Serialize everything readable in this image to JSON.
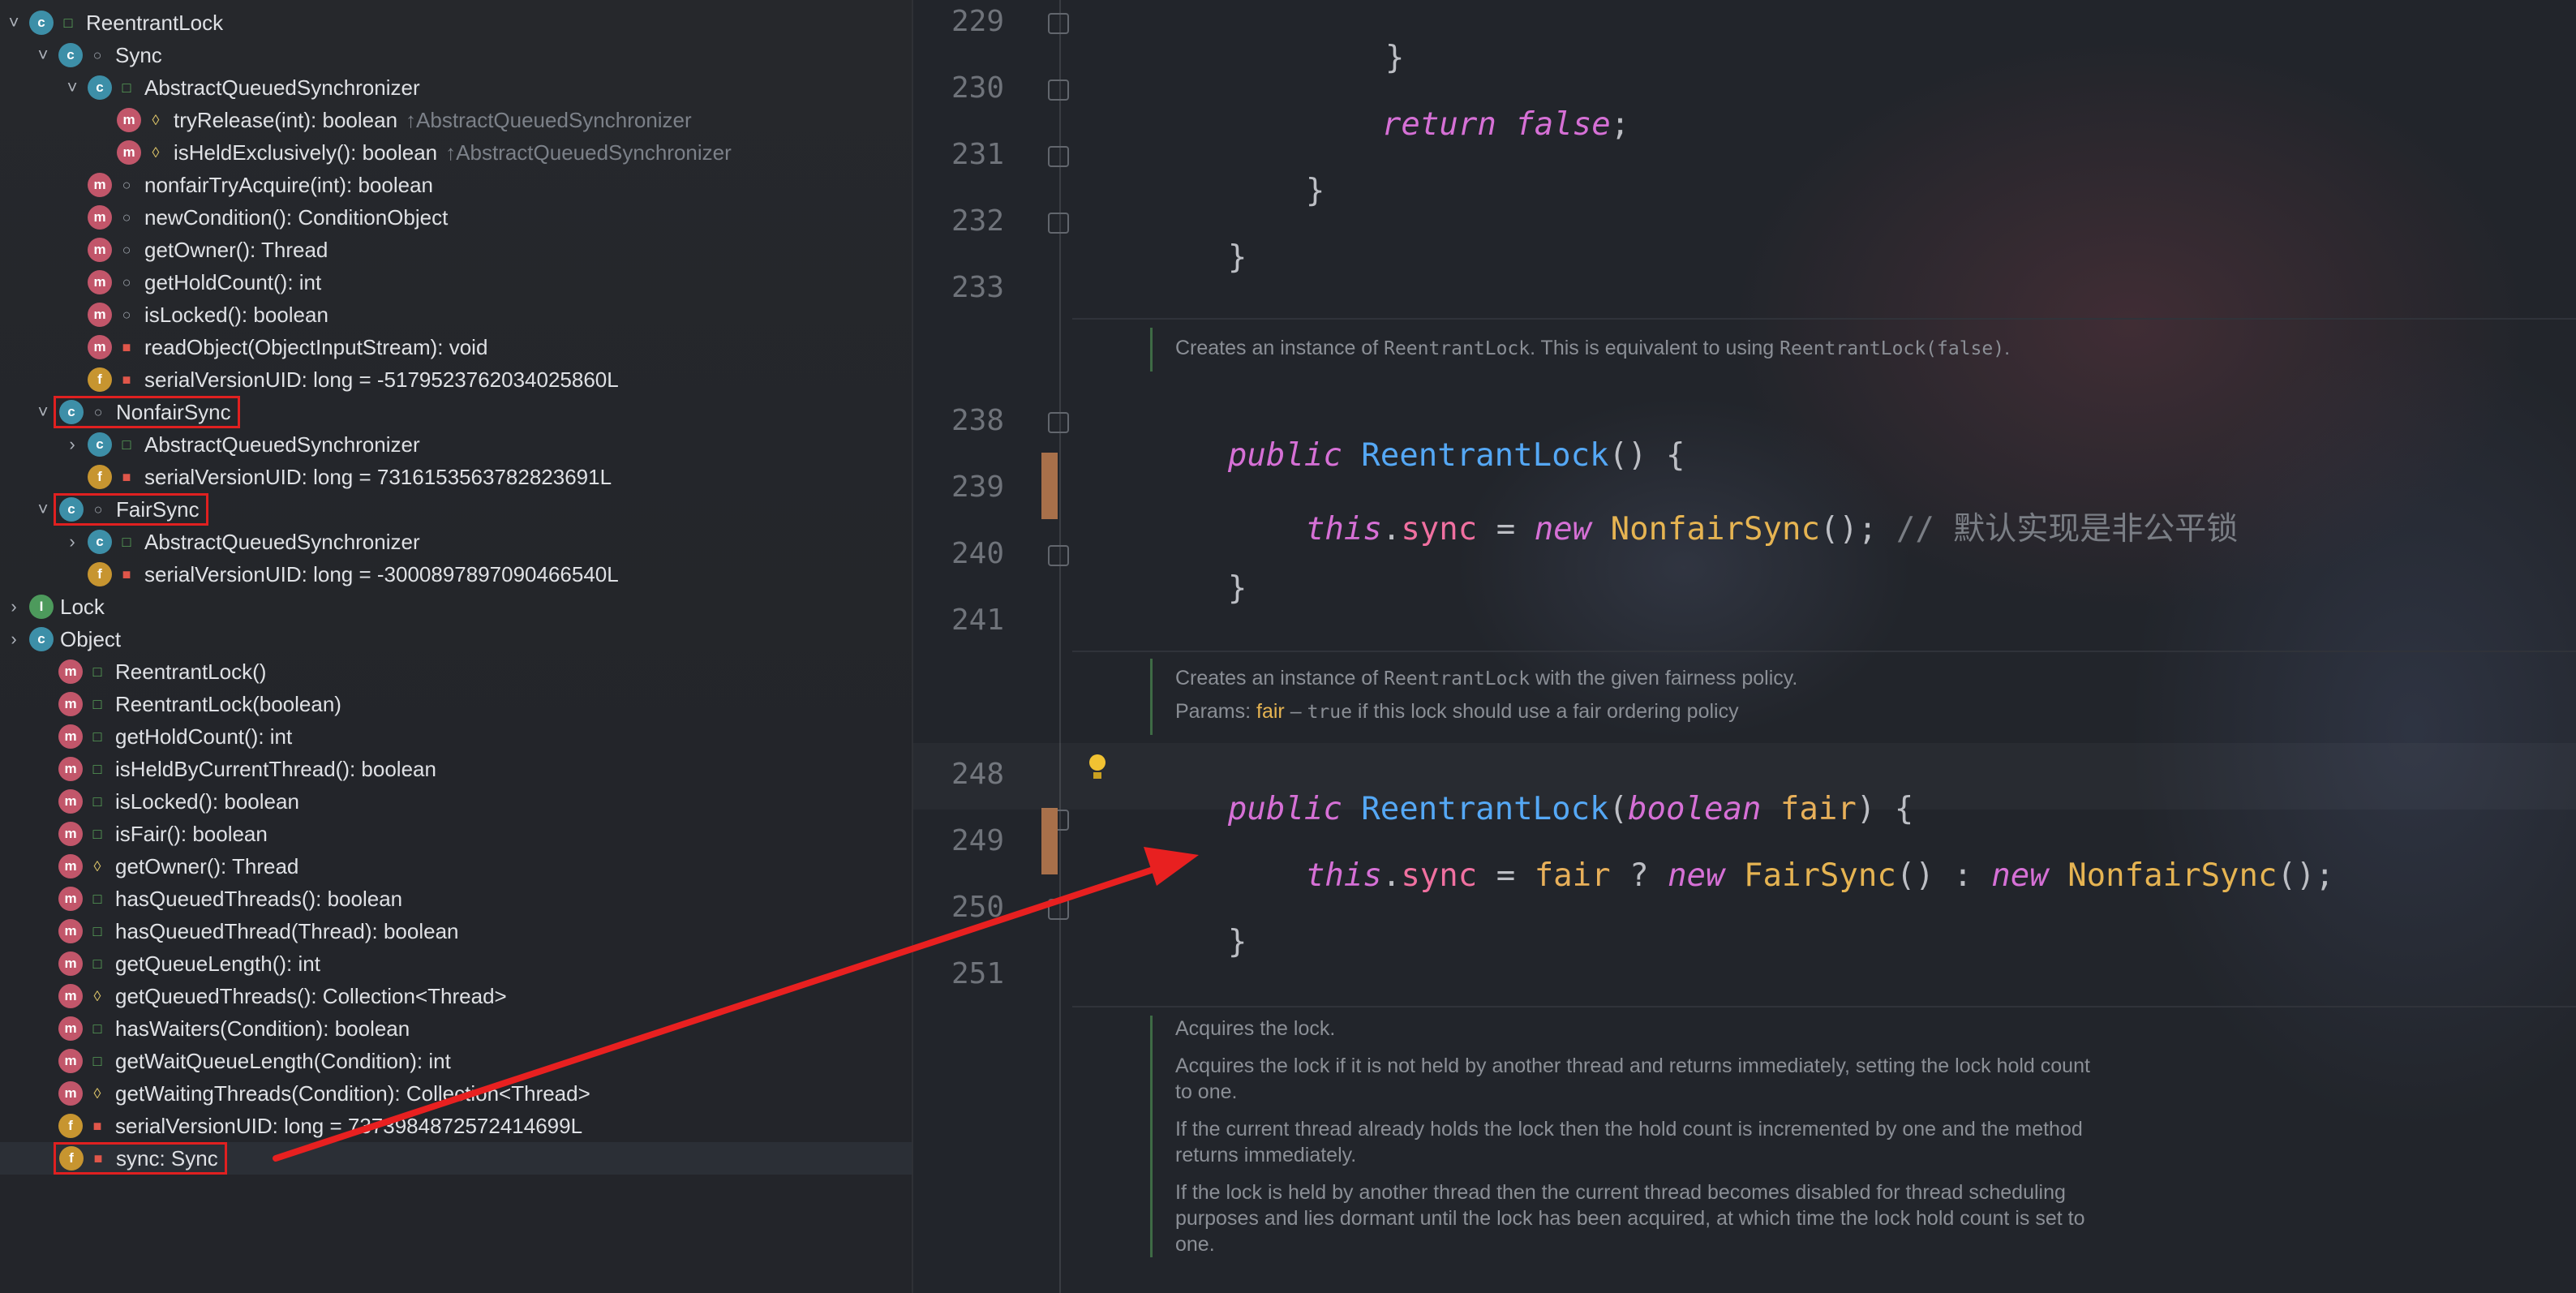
{
  "structure": {
    "rows": [
      {
        "label": "ReentrantLock",
        "icon": "class-icon",
        "vis": "public",
        "indent": 0,
        "chev": "down"
      },
      {
        "label": "Sync",
        "icon": "class-icon",
        "vis": "package",
        "indent": 1,
        "chev": "down"
      },
      {
        "label": "AbstractQueuedSynchronizer",
        "icon": "class-icon",
        "vis": "public",
        "indent": 2,
        "chev": "down"
      },
      {
        "label": "tryRelease(int): boolean",
        "inherit": "↑AbstractQueuedSynchronizer",
        "icon": "method-icon",
        "vis": "protected",
        "indent": 3
      },
      {
        "label": "isHeldExclusively(): boolean",
        "inherit": "↑AbstractQueuedSynchronizer",
        "icon": "method-icon",
        "vis": "protected",
        "indent": 3
      },
      {
        "label": "nonfairTryAcquire(int): boolean",
        "icon": "method-icon",
        "vis": "package",
        "indent": 2
      },
      {
        "label": "newCondition(): ConditionObject",
        "icon": "method-icon",
        "vis": "package",
        "indent": 2
      },
      {
        "label": "getOwner(): Thread",
        "icon": "method-icon",
        "vis": "package",
        "indent": 2
      },
      {
        "label": "getHoldCount(): int",
        "icon": "method-icon",
        "vis": "package",
        "indent": 2
      },
      {
        "label": "isLocked(): boolean",
        "icon": "method-icon",
        "vis": "package",
        "indent": 2
      },
      {
        "label": "readObject(ObjectInputStream): void",
        "icon": "method-icon",
        "vis": "private",
        "indent": 2
      },
      {
        "label": "serialVersionUID: long = -5179523762034025860L",
        "icon": "field-icon",
        "vis": "private",
        "indent": 2
      },
      {
        "label": "NonfairSync",
        "icon": "class-icon",
        "vis": "package",
        "indent": 1,
        "chev": "down",
        "boxed": true
      },
      {
        "label": "AbstractQueuedSynchronizer",
        "icon": "class-icon",
        "vis": "public",
        "indent": 2,
        "chev": "right"
      },
      {
        "label": "serialVersionUID: long = 7316153563782823691L",
        "icon": "field-icon",
        "vis": "private",
        "indent": 2
      },
      {
        "label": "FairSync",
        "icon": "class-icon",
        "vis": "package",
        "indent": 1,
        "chev": "down",
        "boxed": true
      },
      {
        "label": "AbstractQueuedSynchronizer",
        "icon": "class-icon",
        "vis": "public",
        "indent": 2,
        "chev": "right"
      },
      {
        "label": "serialVersionUID: long = -3000897897090466540L",
        "icon": "field-icon",
        "vis": "private",
        "indent": 2
      },
      {
        "label": "Lock",
        "icon": "interface-icon",
        "vis": "none",
        "indent": 0,
        "chev": "right"
      },
      {
        "label": "Object",
        "icon": "class-icon",
        "vis": "none",
        "indent": 0,
        "chev": "right"
      },
      {
        "label": "ReentrantLock()",
        "icon": "method-icon",
        "vis": "public",
        "indent": 1
      },
      {
        "label": "ReentrantLock(boolean)",
        "icon": "method-icon",
        "vis": "public",
        "indent": 1
      },
      {
        "label": "getHoldCount(): int",
        "icon": "method-icon",
        "vis": "public",
        "indent": 1
      },
      {
        "label": "isHeldByCurrentThread(): boolean",
        "icon": "method-icon",
        "vis": "public",
        "indent": 1
      },
      {
        "label": "isLocked(): boolean",
        "icon": "method-icon",
        "vis": "public",
        "indent": 1
      },
      {
        "label": "isFair(): boolean",
        "icon": "method-icon",
        "vis": "public",
        "indent": 1
      },
      {
        "label": "getOwner(): Thread",
        "icon": "method-icon",
        "vis": "protected",
        "indent": 1
      },
      {
        "label": "hasQueuedThreads(): boolean",
        "icon": "method-icon",
        "vis": "public",
        "indent": 1
      },
      {
        "label": "hasQueuedThread(Thread): boolean",
        "icon": "method-icon",
        "vis": "public",
        "indent": 1
      },
      {
        "label": "getQueueLength(): int",
        "icon": "method-icon",
        "vis": "public",
        "indent": 1
      },
      {
        "label": "getQueuedThreads(): Collection<Thread>",
        "icon": "method-icon",
        "vis": "protected",
        "indent": 1
      },
      {
        "label": "hasWaiters(Condition): boolean",
        "icon": "method-icon",
        "vis": "public",
        "indent": 1
      },
      {
        "label": "getWaitQueueLength(Condition): int",
        "icon": "method-icon",
        "vis": "public",
        "indent": 1
      },
      {
        "label": "getWaitingThreads(Condition): Collection<Thread>",
        "icon": "method-icon",
        "vis": "protected",
        "indent": 1
      },
      {
        "label": "serialVersionUID: long = 7373984872572414699L",
        "icon": "field-icon",
        "vis": "private",
        "indent": 1
      },
      {
        "label": "sync: Sync",
        "icon": "field-icon",
        "vis": "private",
        "indent": 1,
        "boxed": true,
        "selected": true
      }
    ]
  },
  "editor": {
    "line_numbers": {
      "l229": "229",
      "l230": "230",
      "l231": "231",
      "l232": "232",
      "l233": "233",
      "l238": "238",
      "l239": "239",
      "l240": "240",
      "l241": "241",
      "l248": "248",
      "l249": "249",
      "l250": "250",
      "l251": "251"
    },
    "code": {
      "l229_brace": "}",
      "l230_return": "return",
      "l230_false": "false",
      "l230_semi": ";",
      "l231_brace": "}",
      "l232_brace": "}",
      "l238_public": "public",
      "l238_name": "ReentrantLock",
      "l238_rest": "() {",
      "l239_this": "this",
      "l239_dot": ".",
      "l239_sync": "sync",
      "l239_eq": " = ",
      "l239_new": "new",
      "l239_type": "NonfairSync",
      "l239_rest": "(); ",
      "l239_comment": "// 默认实现是非公平锁",
      "l240_brace": "}",
      "l248_public": "public",
      "l248_name": "ReentrantLock",
      "l248_open": "(",
      "l248_boolean": "boolean",
      "l248_fair": "fair",
      "l248_rest": ") {",
      "l249_this": "this",
      "l249_dot": ".",
      "l249_sync": "sync",
      "l249_eq": " = ",
      "l249_fair": "fair",
      "l249_q": " ? ",
      "l249_new1": "new",
      "l249_type1": "FairSync",
      "l249_mid": "() : ",
      "l249_new2": "new",
      "l249_type2": "NonfairSync",
      "l249_end": "();",
      "l250_brace": "}"
    },
    "docs": {
      "doc1_a": "Creates an instance of ",
      "doc1_b": "ReentrantLock",
      "doc1_c": ". This is equivalent to using ",
      "doc1_d": "ReentrantLock(false)",
      "doc1_e": ".",
      "doc2_a": "Creates an instance of ",
      "doc2_b": "ReentrantLock",
      "doc2_c": " with the given fairness policy.",
      "doc2_params": "Params: ",
      "doc2_fair": "fair",
      "doc2_dash": " – ",
      "doc2_true": "true",
      "doc2_rest": " if this lock should use a fair ordering policy",
      "doc3_p1": "Acquires the lock.",
      "doc3_p2": "Acquires the lock if it is not held by another thread and returns immediately, setting the lock hold count to one.",
      "doc3_p3": "If the current thread already holds the lock then the hold count is incremented by one and the method returns immediately.",
      "doc3_p4": "If the lock is held by another thread then the current thread becomes disabled for thread scheduling purposes and lies dormant until the lock has been acquired, at which time the lock hold count is set to one."
    }
  },
  "colors": {
    "annotation_red": "#e02020",
    "keyword": "#d670d6",
    "function": "#55a8f5",
    "type": "#e6b452",
    "field": "#f070a0"
  }
}
